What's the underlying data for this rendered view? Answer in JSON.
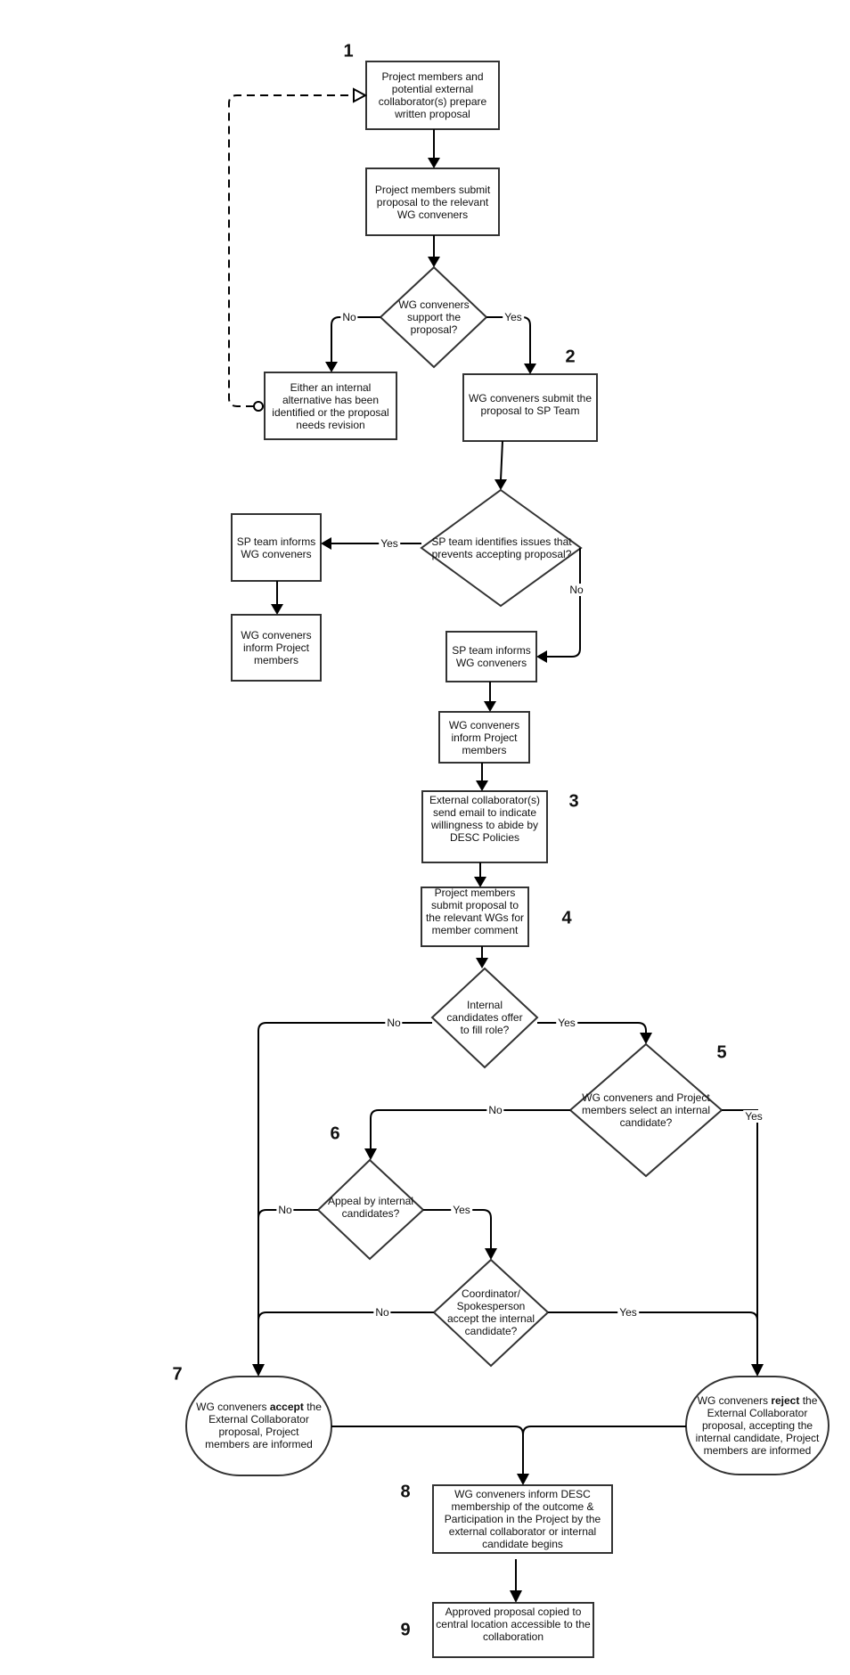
{
  "diagram": {
    "type": "flowchart",
    "colors": {
      "stroke": "#333333",
      "edge": "#000000",
      "text": "#111111",
      "background": "#ffffff"
    },
    "step_numbers": [
      "1",
      "2",
      "3",
      "4",
      "5",
      "6",
      "7",
      "8",
      "9"
    ],
    "nodes": {
      "prepare": "Project members and potential external collaborator(s) prepare written proposal",
      "submit_wg": "Project members submit proposal to the relevant WG conveners",
      "wg_support": "WG conveners support the proposal?",
      "alternative": "Either an internal alternative has been identified or the proposal needs revision",
      "submit_sp": "WG conveners submit the proposal to SP Team",
      "sp_issues": "SP team identifies issues that prevents accepting proposal?",
      "sp_informs_left": "SP team informs WG conveners",
      "wg_inform_left": "WG conveners inform Project members",
      "sp_informs_right": "SP team informs WG conveners",
      "wg_inform_right": "WG conveners inform Project members",
      "ext_email": "External collaborator(s) send email to indicate willingness to abide by DESC Policies",
      "submit_wgs": "Project members submit proposal to the relevant WGs for member comment",
      "internal_offer": "Internal candidates offer to fill role?",
      "select_internal": "WG conveners and Project members select an internal candidate?",
      "appeal": "Appeal by internal candidates?",
      "coordinator": "Coordinator/ Spokesperson accept the internal candidate?",
      "accept": {
        "pre": "WG conveners ",
        "bold": "accept",
        "post": " the External Collaborator proposal, Project members are informed"
      },
      "reject": {
        "pre": "WG conveners ",
        "bold": "reject",
        "post": " the External Collaborator proposal, accepting the internal candidate, Project members are informed"
      },
      "inform_desc": "WG conveners inform DESC membership of the outcome & Participation in the Project by the external collaborator or internal candidate begins",
      "copied": "Approved proposal copied to central location accessible to the collaboration"
    },
    "edge_labels": {
      "support_no": "No",
      "support_yes": "Yes",
      "sp_yes": "Yes",
      "sp_no": "No",
      "offer_no": "No",
      "offer_yes": "Yes",
      "select_no": "No",
      "select_yes": "Yes",
      "appeal_no": "No",
      "appeal_yes": "Yes",
      "coord_no": "No",
      "coord_yes": "Yes"
    }
  }
}
